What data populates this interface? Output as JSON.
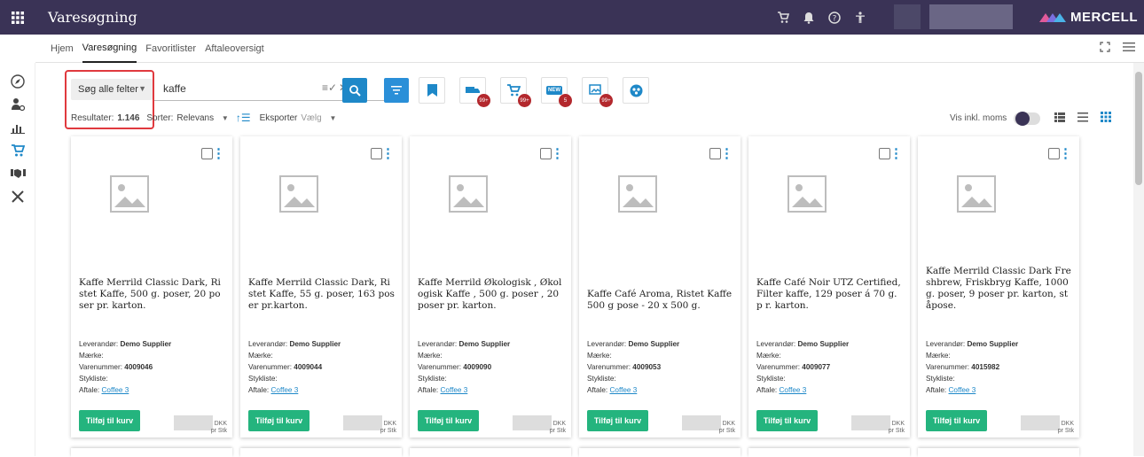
{
  "app": {
    "title": "Varesøgning",
    "logo": "MERCELL",
    "accent": "#3a3356"
  },
  "subnav": {
    "items": [
      "Hjem",
      "Varesøgning",
      "Favoritlister",
      "Aftaleoversigt"
    ],
    "active": 1
  },
  "search": {
    "field_select": "Søg alle felter",
    "query": "kaffe"
  },
  "toolbar": {
    "badges": [
      "99+",
      "99+",
      "5",
      "99+"
    ],
    "new_label": "NEW"
  },
  "results": {
    "label": "Resultater:",
    "count": "1.146",
    "sort_label": "Sorter:",
    "sort_value": "Relevans",
    "export_label": "Eksporter",
    "export_select": "Vælg",
    "vat_label": "Vis inkl. moms"
  },
  "labels": {
    "supplier": "Leverandør:",
    "brand": "Mærke:",
    "itemno": "Varenummer:",
    "bom": "Stykliste:",
    "agreement": "Aftale:",
    "add_to_cart": "Tilføj til kurv",
    "currency": "DKK",
    "per_unit": "pr Stk"
  },
  "products": [
    {
      "title": "Kaffe Merrild Classic Dark, Ri stet Kaffe, 500 g. poser, 20 po ser pr. karton.",
      "supplier": "Demo Supplier",
      "brand": "",
      "itemno": "4009046",
      "agreement": "Coffee 3"
    },
    {
      "title": "Kaffe Merrild Classic Dark, Ri stet Kaffe, 55 g. poser, 163 pos er pr.karton.",
      "supplier": "Demo Supplier",
      "brand": "",
      "itemno": "4009044",
      "agreement": "Coffee 3"
    },
    {
      "title": "Kaffe Merrild Økologisk , Økol ogisk Kaffe , 500 g. poser , 20 poser pr. karton.",
      "supplier": "Demo Supplier",
      "brand": "",
      "itemno": "4009090",
      "agreement": "Coffee 3"
    },
    {
      "title": "Kaffe Café Aroma, Ristet Kaffe 500 g pose - 20 x 500 g.",
      "supplier": "Demo Supplier",
      "brand": "",
      "itemno": "4009053",
      "agreement": "Coffee 3"
    },
    {
      "title": "Kaffe Café Noir UTZ Certified, Filter kaffe, 129 poser á 70 g. p r. karton.",
      "supplier": "Demo Supplier",
      "brand": "",
      "itemno": "4009077",
      "agreement": "Coffee 3"
    },
    {
      "title": "Kaffe Merrild Classic Dark Fre shbrew, Friskbryg Kaffe, 1000 g. poser, 9 poser pr. karton, st åpose.",
      "supplier": "Demo Supplier",
      "brand": "",
      "itemno": "4015982",
      "agreement": "Coffee 3"
    }
  ]
}
